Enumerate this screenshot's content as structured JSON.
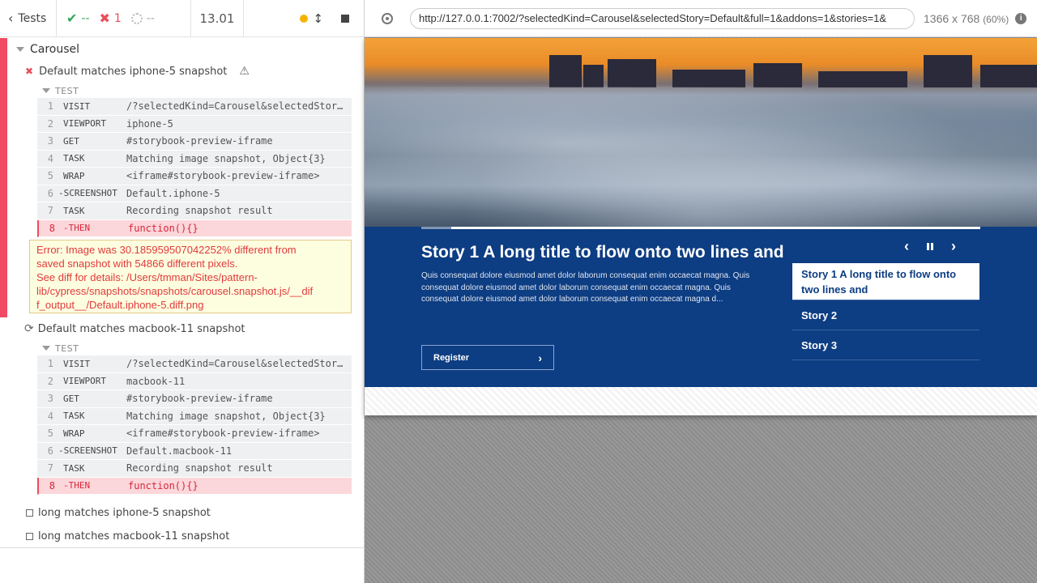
{
  "reporter": {
    "tests_label": "Tests",
    "passed_count": "--",
    "failed_count": "1",
    "pending_count": "--",
    "duration": "13.01",
    "suite_title": "Carousel",
    "tests": [
      {
        "title": "Default matches iphone-5 snapshot",
        "state": "failed",
        "section": "TEST",
        "commands": [
          {
            "num": "1",
            "name": "VISIT",
            "msg": "/?selectedKind=Carousel&selectedStory=Default&full=1"
          },
          {
            "num": "2",
            "name": "VIEWPORT",
            "msg": "iphone-5"
          },
          {
            "num": "3",
            "name": "GET",
            "msg": "#storybook-preview-iframe"
          },
          {
            "num": "4",
            "name": "TASK",
            "msg": "Matching image snapshot, Object{3}"
          },
          {
            "num": "5",
            "name": "WRAP",
            "msg": "<iframe#storybook-preview-iframe>"
          },
          {
            "num": "6",
            "name": "-SCREENSHOT",
            "msg": "Default.iphone-5"
          },
          {
            "num": "7",
            "name": "TASK",
            "msg": "Recording snapshot result"
          },
          {
            "num": "8",
            "name": "-THEN",
            "msg": "function(){}"
          }
        ],
        "error_lines": [
          "Error: Image was 30.185959507042252% different from",
          "saved snapshot with 54866 different pixels.",
          "See diff for details: /Users/tmman/Sites/pattern-",
          "lib/cypress/snapshots/snapshots/carousel.snapshot.js/__dif",
          "f_output__/Default.iphone-5.diff.png"
        ]
      },
      {
        "title": "Default matches macbook-11 snapshot",
        "state": "running",
        "section": "TEST",
        "commands": [
          {
            "num": "1",
            "name": "VISIT",
            "msg": "/?selectedKind=Carousel&selectedStory=Default&full=1"
          },
          {
            "num": "2",
            "name": "VIEWPORT",
            "msg": "macbook-11"
          },
          {
            "num": "3",
            "name": "GET",
            "msg": "#storybook-preview-iframe"
          },
          {
            "num": "4",
            "name": "TASK",
            "msg": "Matching image snapshot, Object{3}"
          },
          {
            "num": "5",
            "name": "WRAP",
            "msg": "<iframe#storybook-preview-iframe>"
          },
          {
            "num": "6",
            "name": "-SCREENSHOT",
            "msg": "Default.macbook-11"
          },
          {
            "num": "7",
            "name": "TASK",
            "msg": "Recording snapshot result"
          },
          {
            "num": "8",
            "name": "-THEN",
            "msg": "function(){}"
          }
        ]
      },
      {
        "title": "long matches iphone-5 snapshot",
        "state": "pending"
      },
      {
        "title": "long matches macbook-11 snapshot",
        "state": "pending"
      }
    ]
  },
  "aut": {
    "url": "http://127.0.0.1:7002/?selectedKind=Carousel&selectedStory=Default&full=1&addons=1&stories=1&",
    "viewport_size": "1366 x 768",
    "viewport_scale": "(60%)",
    "info_icon_glyph": "i",
    "carousel": {
      "title": "Story 1 A long title to flow onto two lines and",
      "description": "Quis consequat dolore eiusmod amet dolor laborum consequat enim occaecat magna. Quis consequat dolore eiusmod amet dolor laborum consequat enim occaecat magna. Quis consequat dolore eiusmod amet dolor laborum consequat enim occaecat magna d...",
      "register_label": "Register",
      "progress_fraction": 0.054,
      "stories": [
        "Story 1 A long title to flow onto two lines and",
        "Story 2",
        "Story 3"
      ]
    }
  },
  "colors": {
    "pass": "#2eaa57",
    "fail": "#e94f5a",
    "running": "#f5b300",
    "carousel_band": "#0d3d82"
  }
}
